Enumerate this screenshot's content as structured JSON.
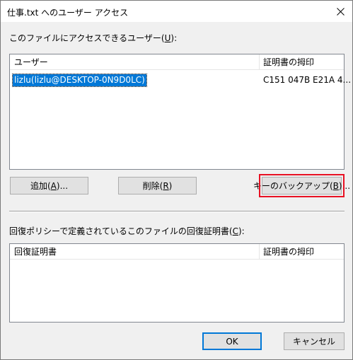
{
  "window": {
    "title": "仕事.txt へのユーザー アクセス"
  },
  "users_section": {
    "label_prefix": "このファイルにアクセスできるユーザー(",
    "label_key": "U",
    "label_suffix": "):",
    "columns": [
      "ユーザー",
      "証明書の拇印"
    ],
    "rows": [
      {
        "user": "lizlu(lizlu@DESKTOP-0N9D0LC)",
        "thumbprint": "C151 047B E21A 4..."
      }
    ]
  },
  "buttons": {
    "add_prefix": "追加(",
    "add_key": "A",
    "add_suffix": ")...",
    "remove_prefix": "削除(",
    "remove_key": "R",
    "remove_suffix": ")",
    "backup_prefix": "キーのバックアップ(",
    "backup_key": "B",
    "backup_suffix": ")...",
    "ok": "OK",
    "cancel": "キャンセル"
  },
  "recovery_section": {
    "label_prefix": "回復ポリシーで定義されているこのファイルの回復証明書(",
    "label_key": "C",
    "label_suffix": "):",
    "columns": [
      "回復証明書",
      "証明書の拇印"
    ]
  },
  "colors": {
    "selection": "#0078d7",
    "highlight_box": "#e81123"
  }
}
